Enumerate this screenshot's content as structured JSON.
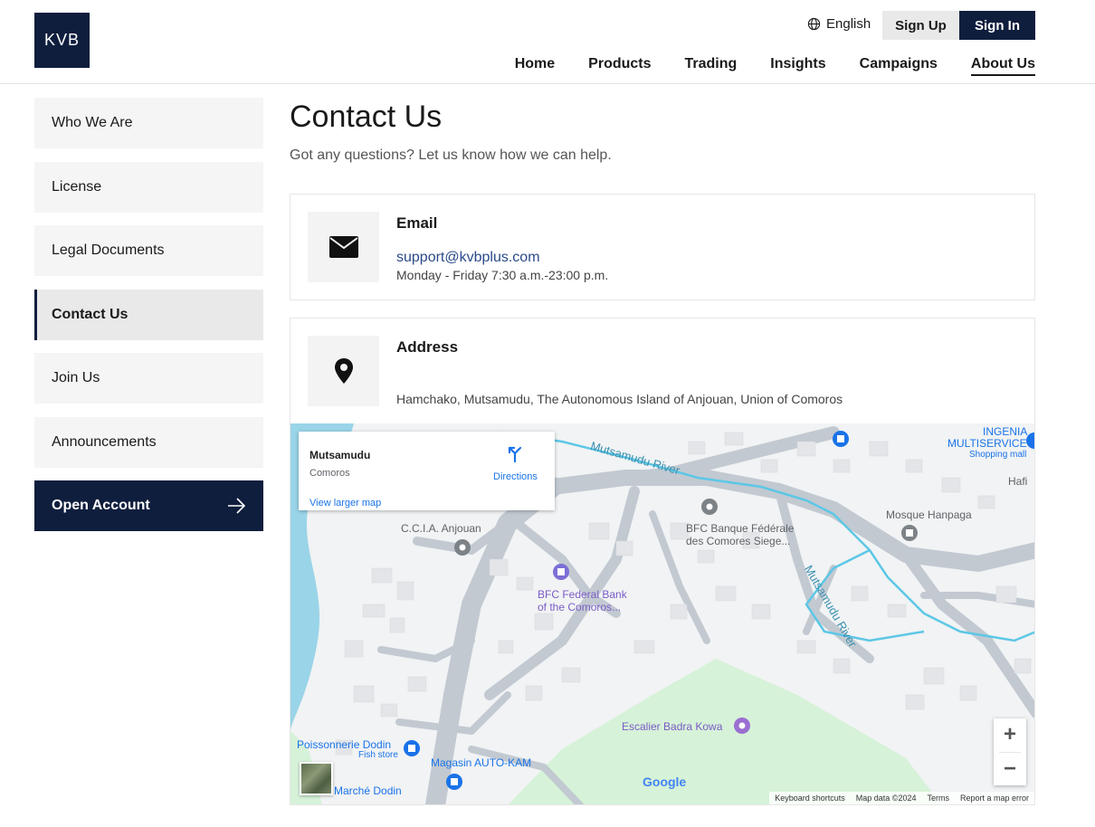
{
  "header": {
    "logo": "KVB",
    "language": "English",
    "sign_up": "Sign Up",
    "sign_in": "Sign In",
    "nav": [
      "Home",
      "Products",
      "Trading",
      "Insights",
      "Campaigns",
      "About Us"
    ],
    "active_nav": "About Us"
  },
  "sidebar": {
    "items": [
      "Who We Are",
      "License",
      "Legal Documents",
      "Contact Us",
      "Join Us",
      "Announcements"
    ],
    "active": "Contact Us",
    "cta": "Open Account"
  },
  "main": {
    "title": "Contact Us",
    "subtitle": "Got any questions? Let us know how we can help.",
    "email_card": {
      "title": "Email",
      "email": "support@kvbplus.com",
      "hours": "Monday - Friday 7:30 a.m.-23:00 p.m."
    },
    "address_card": {
      "title": "Address",
      "address": "Hamchako, Mutsamudu, The Autonomous Island of Anjouan, Union of Comoros"
    }
  },
  "map": {
    "infobox": {
      "name": "Mutsamudu",
      "country": "Comoros",
      "directions": "Directions",
      "larger_map": "View larger map"
    },
    "labels": {
      "ccia": "C.C.I.A. Anjouan",
      "bfc_siege_1": "BFC Banque Fédérale",
      "bfc_siege_2": "des Comores Siege...",
      "bfc_bank_1": "BFC Federal Bank",
      "bfc_bank_2": "of the Comoros...",
      "mosque": "Mosque Hanpaga",
      "ingenia_1": "INGENIA",
      "ingenia_2": "MULTISERVICE",
      "ingenia_3": "Shopping mall",
      "hafi": "Hafi",
      "river_1": "Mutsamudu River",
      "river_2": "Mutsamudu River",
      "escalier": "Escalier Badra Kowa",
      "poisson_1": "Poissonnerie Dodin",
      "poisson_2": "Fish store",
      "magasin": "Magasin AUTO-KAM",
      "marche": "Marché Dodin"
    },
    "zoom_in": "+",
    "zoom_out": "−",
    "logo": "Google",
    "footer": [
      "Keyboard shortcuts",
      "Map data ©2024",
      "Terms",
      "Report a map error"
    ]
  },
  "colors": {
    "brand": "#0f1e3d",
    "link": "#2a4a8a",
    "map_water": "#9ad4e8",
    "map_park": "#d6f2d8"
  }
}
